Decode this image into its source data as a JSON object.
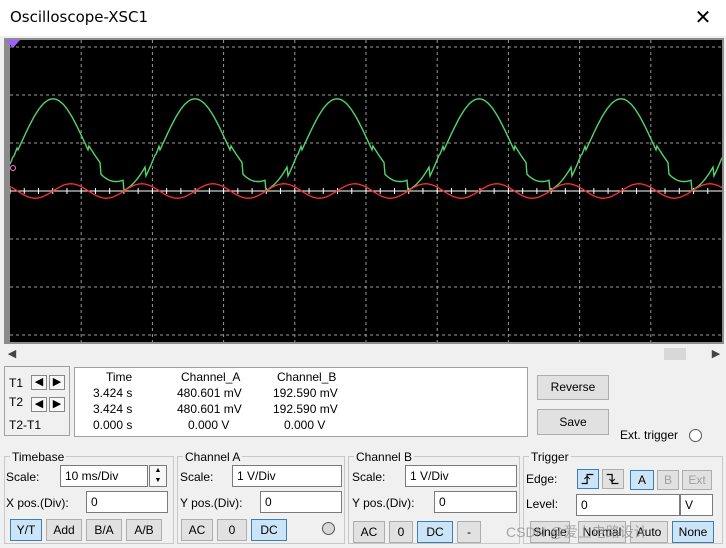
{
  "window": {
    "title": "Oscilloscope-XSC1",
    "close_glyph": "✕"
  },
  "screen": {
    "background": "#000000",
    "grid_color": "#9a9a9a",
    "channel_a_color": "#ff3030",
    "channel_b_color": "#52d56a",
    "grid_divisions": {
      "horizontal": 10,
      "vertical": 6
    }
  },
  "cursors": {
    "t1_label": "T1",
    "t2_label": "T2",
    "t2t1_label": "T2-T1",
    "left_arrow": "◀",
    "right_arrow": "▶"
  },
  "readout": {
    "headers": [
      "Time",
      "Channel_A",
      "Channel_B"
    ],
    "rows": [
      [
        "3.424 s",
        "480.601 mV",
        "192.590 mV"
      ],
      [
        "3.424 s",
        "480.601 mV",
        "192.590 mV"
      ],
      [
        "0.000 s",
        "0.000 V",
        "0.000 V"
      ]
    ]
  },
  "side": {
    "reverse_label": "Reverse",
    "save_label": "Save",
    "ext_trigger_label": "Ext. trigger"
  },
  "timebase": {
    "title": "Timebase",
    "scale_label": "Scale:",
    "scale_value": "10 ms/Div",
    "xpos_label": "X pos.(Div):",
    "xpos_value": "0",
    "modes": [
      "Y/T",
      "Add",
      "B/A",
      "A/B"
    ]
  },
  "channel_a": {
    "title": "Channel A",
    "scale_label": "Scale:",
    "scale_value": "1  V/Div",
    "ypos_label": "Y pos.(Div):",
    "ypos_value": "0",
    "coupling": [
      "AC",
      "0",
      "DC"
    ]
  },
  "channel_b": {
    "title": "Channel B",
    "scale_label": "Scale:",
    "scale_value": "1  V/Div",
    "ypos_label": "Y pos.(Div):",
    "ypos_value": "0",
    "coupling": [
      "AC",
      "0",
      "DC",
      "-"
    ]
  },
  "trigger": {
    "title": "Trigger",
    "edge_label": "Edge:",
    "sources": [
      "A",
      "B",
      "Ext"
    ],
    "level_label": "Level:",
    "level_value": "0",
    "level_unit": "V",
    "modes": [
      "Single",
      "Normal",
      "Auto",
      "None"
    ]
  },
  "watermark": "CSDN @爱上电路设计"
}
